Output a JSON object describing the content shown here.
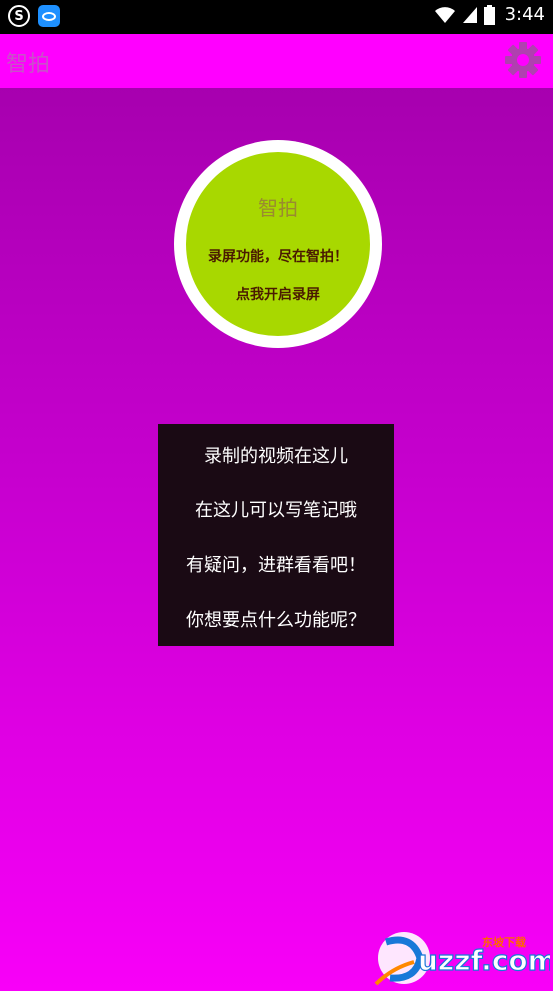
{
  "status_bar": {
    "left_icons": [
      "s-app-icon",
      "browser-app-icon"
    ],
    "right_icons": [
      "wifi-icon",
      "signal-icon",
      "battery-icon"
    ],
    "time": "3:44"
  },
  "app_bar": {
    "title": "智拍",
    "settings_icon": "gear-icon"
  },
  "record_button": {
    "title": "智拍",
    "line1": "录屏功能，尽在智拍！",
    "line2": "点我开启录屏"
  },
  "menu": {
    "items": [
      {
        "label": "录制的视频在这儿"
      },
      {
        "label": "在这儿可以写笔记哦"
      },
      {
        "label": "有疑问，进群看看吧！"
      },
      {
        "label": "你想要点什么功能呢？"
      }
    ]
  },
  "watermark": {
    "text": "uzzf.com",
    "subtext": "东坡下载"
  },
  "colors": {
    "app_bar": "#ff00ff",
    "background_top": "#a000a8",
    "background_bottom": "#f800f8",
    "record_button": "#a8d800",
    "menu_background": "#1a0a14"
  }
}
